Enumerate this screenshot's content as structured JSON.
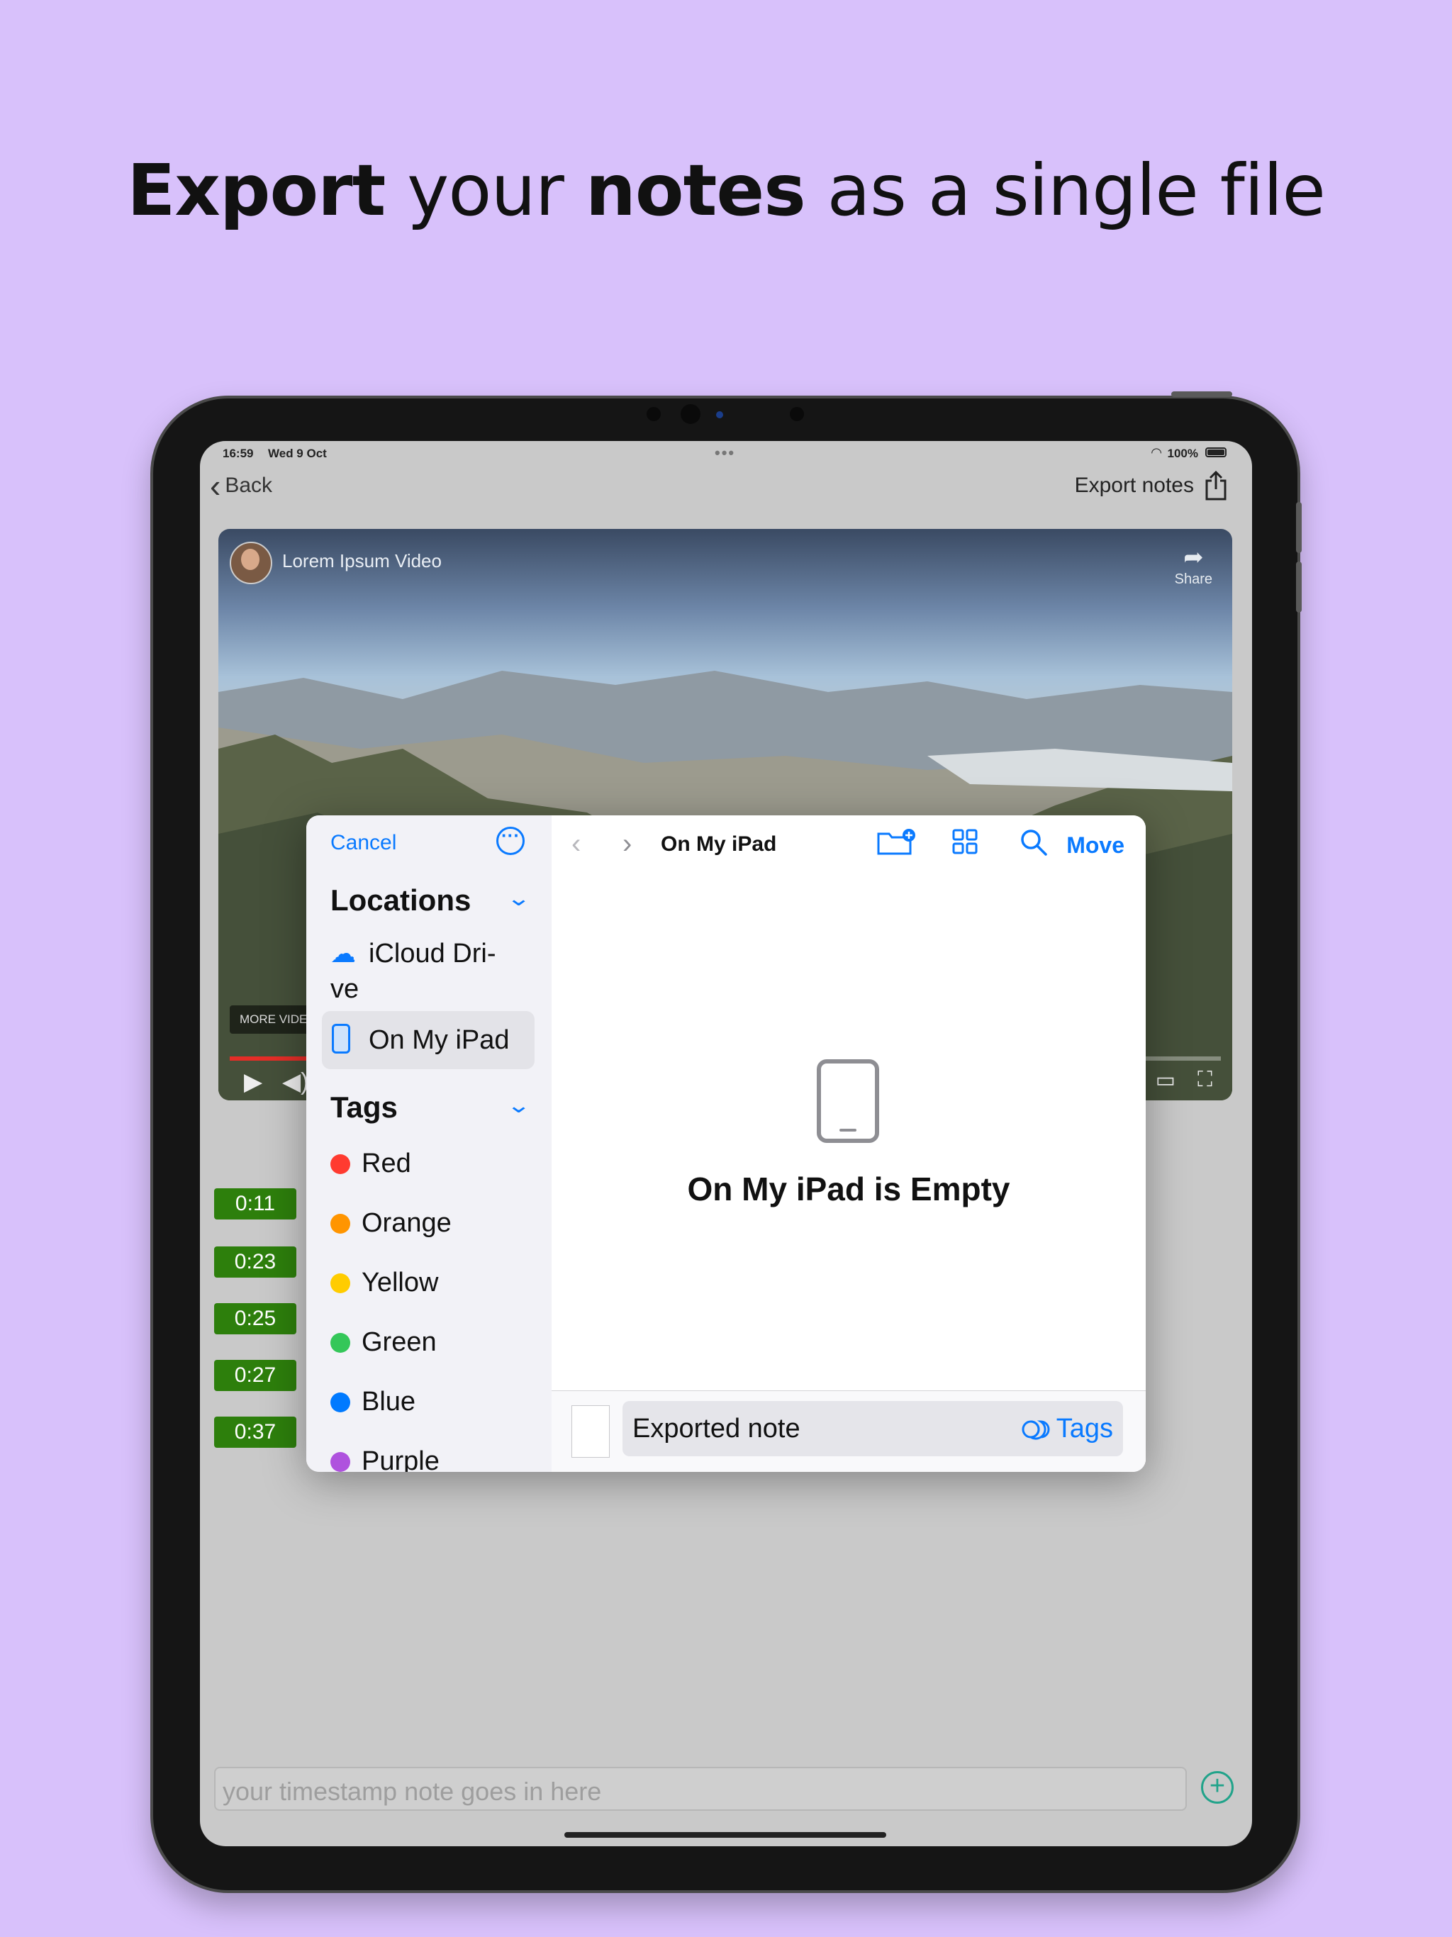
{
  "headline": {
    "part1": "Export",
    "part2": " your ",
    "part3": "notes",
    "part4": " as a single file"
  },
  "status_bar": {
    "time": "16:59",
    "date": "Wed 9 Oct",
    "battery": "100%"
  },
  "nav": {
    "back_label": "Back",
    "export_label": "Export notes"
  },
  "video": {
    "title": "Lorem Ipsum Video",
    "share_label": "Share",
    "more_label": "MORE VIDEOS",
    "progress_fraction": 0.08
  },
  "timestamps": [
    "0:11",
    "0:23",
    "0:25",
    "0:27",
    "0:37"
  ],
  "note_input": {
    "placeholder": "your timestamp note goes in here"
  },
  "picker": {
    "cancel_label": "Cancel",
    "locations_title": "Locations",
    "locations": [
      {
        "label": "iCloud Dri-ve",
        "line1": "iCloud Dri-",
        "line2": "ve",
        "icon": "cloud-icon"
      },
      {
        "label": "On My iPad",
        "icon": "ipad-icon",
        "selected": true
      }
    ],
    "tags_title": "Tags",
    "tags": [
      {
        "label": "Red",
        "color": "#ff3b30"
      },
      {
        "label": "Orange",
        "color": "#ff9500"
      },
      {
        "label": "Yellow",
        "color": "#ffcc00"
      },
      {
        "label": "Green",
        "color": "#34c759"
      },
      {
        "label": "Blue",
        "color": "#007aff"
      },
      {
        "label": "Purple",
        "color": "#af52de"
      }
    ],
    "location_title": "On My iPad",
    "move_label": "Move",
    "empty_text": "On My iPad is Empty",
    "file_name": "Exported note",
    "tags_button": "Tags"
  },
  "colors": {
    "accent": "#0a7aff",
    "background": "#d8c1fb",
    "stamp_green": "#2d7f0c",
    "add_button": "#21a38a"
  }
}
